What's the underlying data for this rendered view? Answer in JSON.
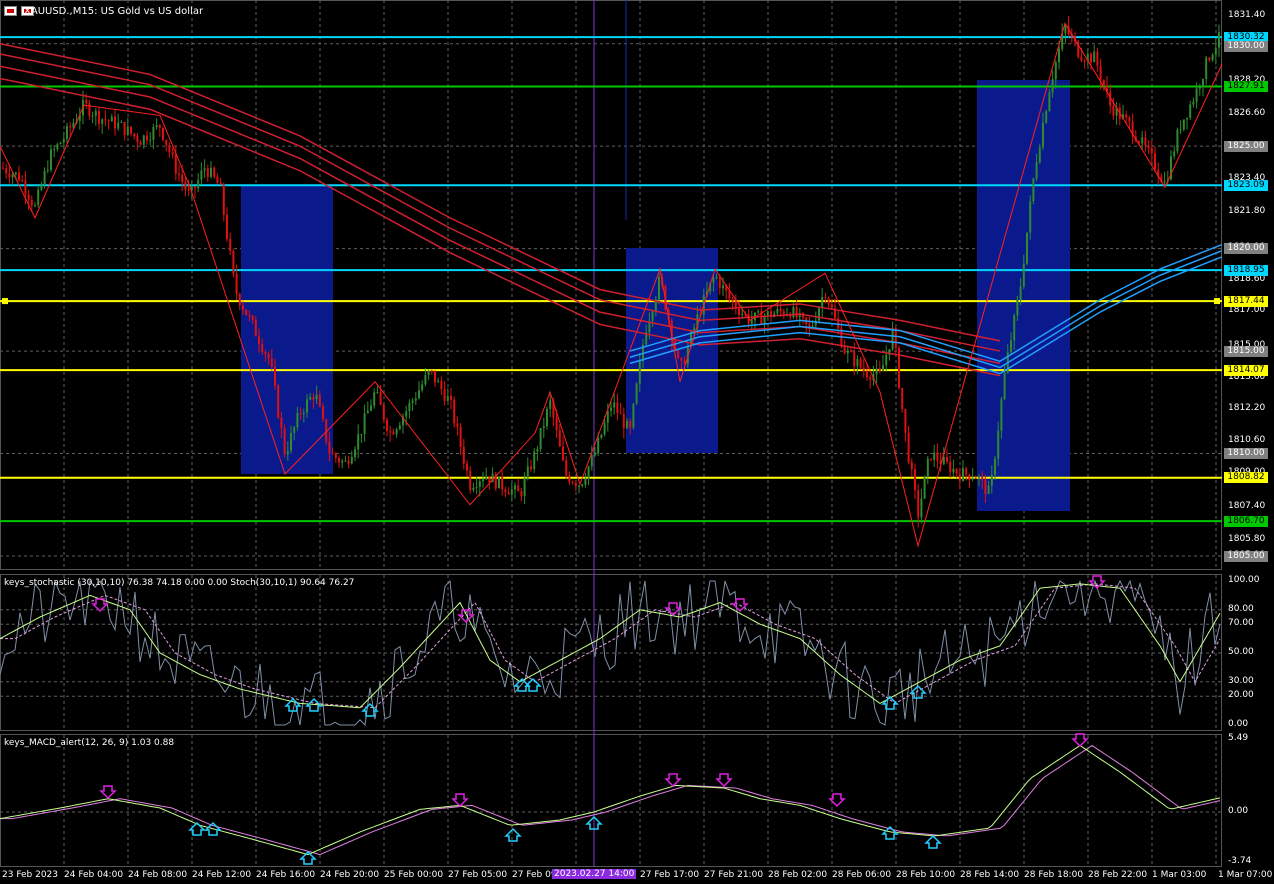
{
  "window": {
    "title": "XAUUSD.,M15:  US Gold vs US dollar",
    "icons": [
      "chart-icon",
      "chart-properties-icon"
    ]
  },
  "indicators": {
    "stochastic_label": "keys_stochastic (30,10,10) 76.38 74.18 0.00 0.00 Stoch(30,10,1) 90.64 76.27",
    "macd_label": "keys_MACD_alert(12, 26, 9) 1.03 0.88"
  },
  "price_axis": {
    "ticks": [
      "1831.40",
      "1828.20",
      "1826.60",
      "1825.00",
      "1823.40",
      "1821.80",
      "1820.00",
      "1818.60",
      "1817.00",
      "1815.00",
      "1813.60",
      "1812.20",
      "1810.60",
      "1809.00",
      "1807.40",
      "1805.80",
      "1805.00"
    ],
    "tags": [
      {
        "value": "1830.32",
        "bg": "#00d7ff",
        "fg": "#000"
      },
      {
        "value": "1830.00",
        "bg": "#808080",
        "fg": "#fff"
      },
      {
        "value": "1827.91",
        "bg": "#00c800",
        "fg": "#000"
      },
      {
        "value": "1825.00",
        "bg": "#808080",
        "fg": "#fff"
      },
      {
        "value": "1823.09",
        "bg": "#00d7ff",
        "fg": "#000"
      },
      {
        "value": "1820.00",
        "bg": "#808080",
        "fg": "#fff"
      },
      {
        "value": "1818.95",
        "bg": "#00d7ff",
        "fg": "#000"
      },
      {
        "value": "1817.44",
        "bg": "#ffff00",
        "fg": "#000"
      },
      {
        "value": "1815.00",
        "bg": "#808080",
        "fg": "#fff"
      },
      {
        "value": "1814.07",
        "bg": "#ffff00",
        "fg": "#000"
      },
      {
        "value": "1810.00",
        "bg": "#808080",
        "fg": "#fff"
      },
      {
        "value": "1808.82",
        "bg": "#ffff00",
        "fg": "#000"
      },
      {
        "value": "1806.70",
        "bg": "#00c800",
        "fg": "#000"
      },
      {
        "value": "1805.00",
        "bg": "#808080",
        "fg": "#fff"
      }
    ]
  },
  "stoch_axis": [
    "100.00",
    "80.00",
    "70.00",
    "50.00",
    "30.00",
    "20.00",
    "0.00"
  ],
  "macd_axis": [
    "5.49",
    "0.00",
    "-3.74"
  ],
  "time_axis": {
    "labels": [
      "23 Feb 2023",
      "24 Feb 04:00",
      "24 Feb 08:00",
      "24 Feb 12:00",
      "24 Feb 16:00",
      "24 Feb 20:00",
      "25 Feb 00:00",
      "27 Feb 05:00",
      "27 Feb 09",
      "27 Feb 17:00",
      "27 Feb 21:00",
      "28 Feb 02:00",
      "28 Feb 06:00",
      "28 Feb 10:00",
      "28 Feb 14:00",
      "28 Feb 18:00",
      "28 Feb 22:00",
      "1 Mar 03:00",
      "1 Mar 07:00"
    ],
    "highlighted": "2023.02.27 14:00"
  },
  "colors": {
    "background": "#000000",
    "bull_candle": "#2e8b2e",
    "bear_candle": "#e01010",
    "box_fill": "#0a1a8c",
    "ma_red": "#d02030",
    "ma_blue": "#20a0ff",
    "zigzag": "#ff2020",
    "grid": "#606060",
    "cyan_level": "#00d7ff",
    "green_level": "#00c800",
    "yellow_level": "#ffff00",
    "arrow_down": "#e020e0",
    "arrow_up": "#20d0ff",
    "cursor_line": "#7a3cc8"
  }
}
